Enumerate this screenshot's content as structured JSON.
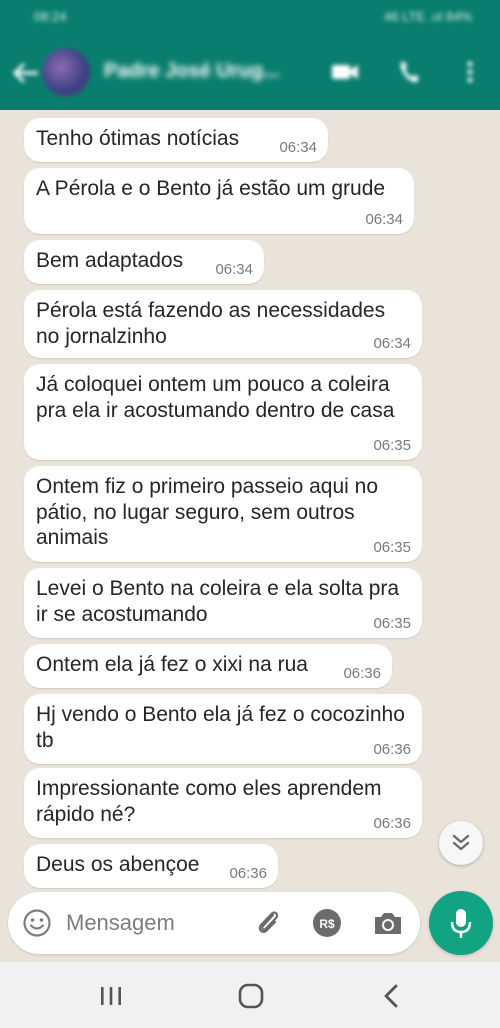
{
  "status_bar": {
    "time": "08:24",
    "icons": "46 LTE .ııl 84%"
  },
  "header": {
    "contact_name": "Padre José Urug..."
  },
  "messages": [
    {
      "text": "Tenho ótimas notícias",
      "time": "06:34"
    },
    {
      "text": "A Pérola e o Bento já estão um grude",
      "time": "06:34"
    },
    {
      "text": "Bem adaptados",
      "time": "06:34"
    },
    {
      "text": "Pérola está fazendo as necessidades no jornalzinho",
      "time": "06:34"
    },
    {
      "text": "Já coloquei ontem um pouco a coleira pra ela ir acostumando dentro de casa",
      "time": "06:35"
    },
    {
      "text": "Ontem fiz o primeiro passeio aqui no pátio, no lugar seguro, sem outros animais",
      "time": "06:35"
    },
    {
      "text": "Levei o Bento na coleira e ela solta pra ir se acostumando",
      "time": "06:35"
    },
    {
      "text": "Ontem ela já fez o xixi na rua",
      "time": "06:36"
    },
    {
      "text": "Hj vendo o Bento ela já fez o cocozinho tb",
      "time": "06:36"
    },
    {
      "text": "Impressionante como eles aprendem rápido né?",
      "time": "06:36"
    },
    {
      "text": "Deus os abençoe",
      "time": "06:36"
    }
  ],
  "input": {
    "placeholder": "Mensagem"
  },
  "icons": {
    "back": "arrow-left-icon",
    "video": "video-camera-icon",
    "call": "phone-icon",
    "menu": "more-vertical-icon",
    "emoji": "emoji-icon",
    "attach": "paperclip-icon",
    "pay": "payment-rs-icon",
    "camera": "camera-icon",
    "mic": "microphone-icon",
    "scroll": "double-chevron-down-icon"
  },
  "colors": {
    "header": "#0a7e6e",
    "accent": "#12a383",
    "chat_bg": "#e9e3da",
    "bubble": "#ffffff"
  }
}
